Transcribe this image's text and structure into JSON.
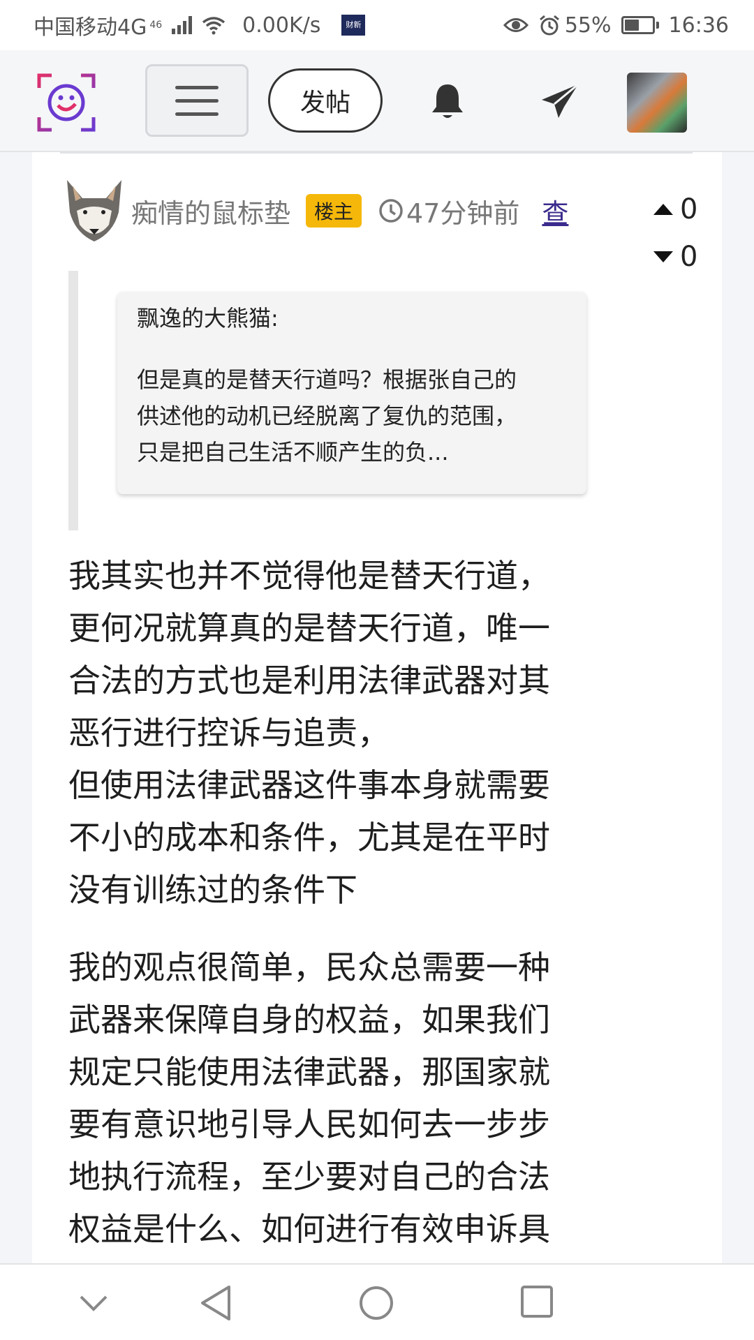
{
  "status_bar": {
    "carrier": "中国移动4G",
    "signal_tag": "46",
    "speed": "0.00K/s",
    "news_badge": "财新",
    "battery": "55%",
    "battery_level": 0.55,
    "time": "16:36"
  },
  "nav": {
    "post_label": "发帖"
  },
  "post": {
    "author": "痴情的鼠标垫",
    "owner_badge": "楼主",
    "time_ago": "47分钟前",
    "view_link": "查",
    "upvotes": "0",
    "downvotes": "0",
    "quote": {
      "author": "飘逸的大熊猫:",
      "lines": [
        "但是真的是替天行道吗？根据张自己的",
        "供述他的动机已经脱离了复仇的范围，",
        "只是把自己生活不顺产生的负..."
      ]
    },
    "paragraphs": [
      {
        "lines": [
          "我其实也并不觉得他是替天行道，",
          "更何况就算真的是替天行道，唯一",
          "合法的方式也是利用法律武器对其",
          "恶行进行控诉与追责，",
          "但使用法律武器这件事本身就需要",
          "不小的成本和条件，尤其是在平时",
          "没有训练过的条件下"
        ]
      },
      {
        "lines": [
          "我的观点很简单，民众总需要一种",
          "武器来保障自身的权益，如果我们",
          "规定只能使用法律武器，那国家就",
          "要有意识地引导人民如何去一步步",
          "地执行流程，至少要对自己的合法",
          "权益是什么、如何进行有效申诉具"
        ]
      }
    ]
  },
  "colors": {
    "owner_badge_bg": "#f5b80a",
    "view_link": "#3b2a8c",
    "logo_magenta": "#e0306a",
    "logo_purple": "#6a3ad0"
  },
  "icons": [
    "eye-icon",
    "alarm-icon",
    "wifi-icon",
    "bell-icon",
    "send-icon",
    "clock-icon",
    "back-icon",
    "home-icon",
    "recents-icon",
    "chevron-down-icon"
  ]
}
